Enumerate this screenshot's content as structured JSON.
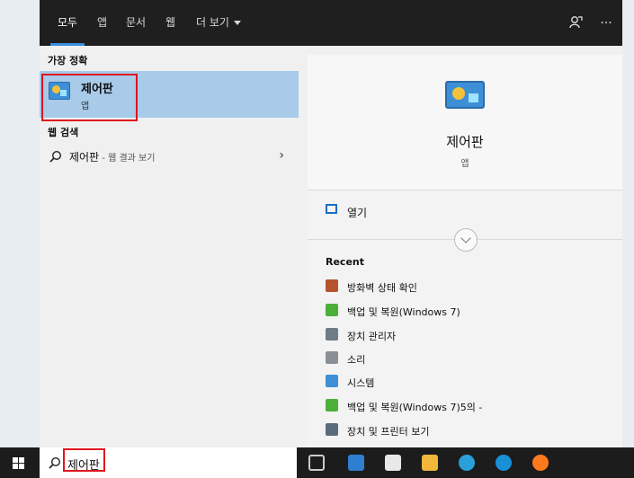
{
  "tabs": [
    {
      "label": "모두"
    },
    {
      "label": "앱"
    },
    {
      "label": "문서"
    },
    {
      "label": "웹"
    },
    {
      "label": "더 보기"
    }
  ],
  "best_match": {
    "section_title": "가장 정확",
    "name": "제어판",
    "type": "앱"
  },
  "web_search": {
    "section_title": "웹 검색",
    "query": "제어판",
    "hint": " - 웹 결과 보기"
  },
  "detail": {
    "title": "제어판",
    "subtitle": "앱",
    "open_label": "열기"
  },
  "recent": {
    "title": "Recent",
    "items": [
      {
        "label": "방화벽 상태 확인"
      },
      {
        "label": "백업 및 복원(Windows 7)"
      },
      {
        "label": "장치 관리자"
      },
      {
        "label": "소리"
      },
      {
        "label": "시스템"
      },
      {
        "label": "백업 및 복원(Windows 7)5의 -"
      },
      {
        "label": "장치 및 프린터 보기"
      }
    ]
  },
  "taskbar": {
    "search_value": "제어판"
  },
  "icons": {
    "feedback": "feedback-icon",
    "more": "more-options-icon",
    "app": "control-panel-icon"
  },
  "colors": {
    "selection": "#a7cbe9",
    "accent": "#3c8fde",
    "highlight_box": "#e0141e"
  }
}
